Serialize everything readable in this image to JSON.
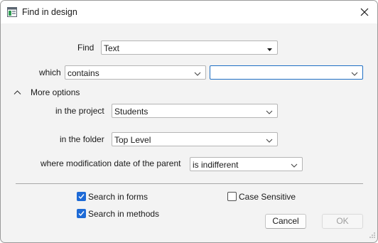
{
  "window": {
    "title": "Find in design",
    "app_icon": "window-icon",
    "close_icon": "close-icon"
  },
  "find": {
    "label": "Find",
    "value": "Text"
  },
  "which": {
    "label": "which",
    "operator": "contains",
    "value": ""
  },
  "more_options": {
    "label": "More options",
    "icon": "chevron-up-icon"
  },
  "project": {
    "label": "in the project",
    "value": "Students"
  },
  "folder": {
    "label": "in the folder",
    "value": "Top Level"
  },
  "mod_date": {
    "label": "where modification date of the parent",
    "value": "is indifferent"
  },
  "options": {
    "search_forms": {
      "label": "Search in forms",
      "checked": true
    },
    "search_methods": {
      "label": "Search in methods",
      "checked": true
    },
    "case_sensitive": {
      "label": "Case Sensitive",
      "checked": false
    }
  },
  "buttons": {
    "cancel": "Cancel",
    "ok": "OK"
  },
  "colors": {
    "accent": "#1d6ad6",
    "focus_border": "#1f6fc4",
    "dialog_bg": "#f3f3f3"
  }
}
